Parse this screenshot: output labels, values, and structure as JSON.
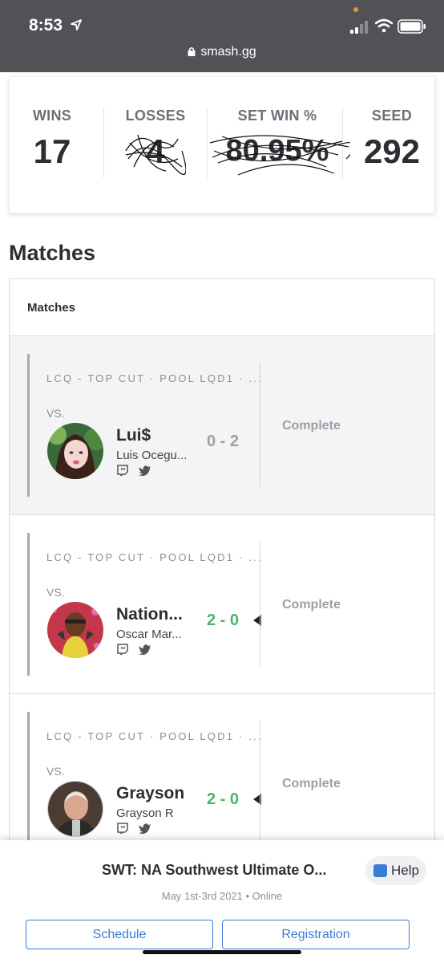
{
  "status_bar": {
    "time": "8:53",
    "url": "smash.gg"
  },
  "stats": [
    {
      "label": "WINS",
      "value": "17"
    },
    {
      "label": "LOSSES",
      "value": "4"
    },
    {
      "label": "SET WIN %",
      "value": "80.95%"
    },
    {
      "label": "SEED",
      "value": "292"
    }
  ],
  "section_title": "Matches",
  "panel_header": "Matches",
  "matches": [
    {
      "meta": "LCQ - TOP CUT · POOL LQD1 · ...",
      "vs": "VS.",
      "player": "Lui$",
      "real_name": "Luis Ocegu...",
      "score": "0 - 2",
      "result": "loss",
      "status": "Complete"
    },
    {
      "meta": "LCQ - TOP CUT · POOL LQD1 · ...",
      "vs": "VS.",
      "player": "Nation...",
      "real_name": "Oscar Mar...",
      "score": "2 - 0",
      "result": "win",
      "status": "Complete"
    },
    {
      "meta": "LCQ - TOP CUT · POOL LQD1 · ...",
      "vs": "VS.",
      "player": "Grayson",
      "real_name": "Grayson R",
      "score": "2 - 0",
      "result": "win",
      "status": "Complete"
    }
  ],
  "event": {
    "title": "SWT: NA Southwest Ultimate O...",
    "subtitle": "May 1st-3rd 2021 • Online",
    "help_label": "Help",
    "schedule_label": "Schedule",
    "registration_label": "Registration"
  },
  "colors": {
    "accent_blue": "#3a7bd5",
    "win_green": "#4ab56a",
    "status_bar": "#505256"
  }
}
